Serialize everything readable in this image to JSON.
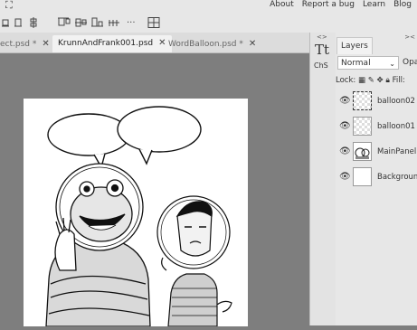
{
  "menu": {
    "items": [
      "About",
      "Report a bug",
      "Learn",
      "Blog"
    ]
  },
  "toolbar": {
    "icons": [
      "transform-controls-icon",
      "align-icon",
      "distribute-icon",
      "overflow-menu-icon"
    ],
    "more_label": "..."
  },
  "tabs": [
    {
      "label": "ect.psd *",
      "close": "✕",
      "active": false
    },
    {
      "label": "KrunnAndFrank001.psd",
      "close": "✕",
      "active": true
    },
    {
      "label": "WordBalloon.psd *",
      "close": "✕",
      "active": false
    }
  ],
  "side_strip": {
    "collapse_label": "<>",
    "char_label": "ChS"
  },
  "layers_panel": {
    "tab_label": "Layers",
    "collapse_label": "><",
    "blend_mode": "Normal",
    "opacity_label": "Opa",
    "lock_label": "Lock:",
    "fill_label": "Fill:",
    "layers": [
      {
        "name": "balloon02",
        "visible": true,
        "selected": true
      },
      {
        "name": "balloon01",
        "visible": true,
        "selected": false
      },
      {
        "name": "MainPanel",
        "visible": true,
        "selected": false
      },
      {
        "name": "Background",
        "visible": true,
        "selected": false
      }
    ]
  }
}
